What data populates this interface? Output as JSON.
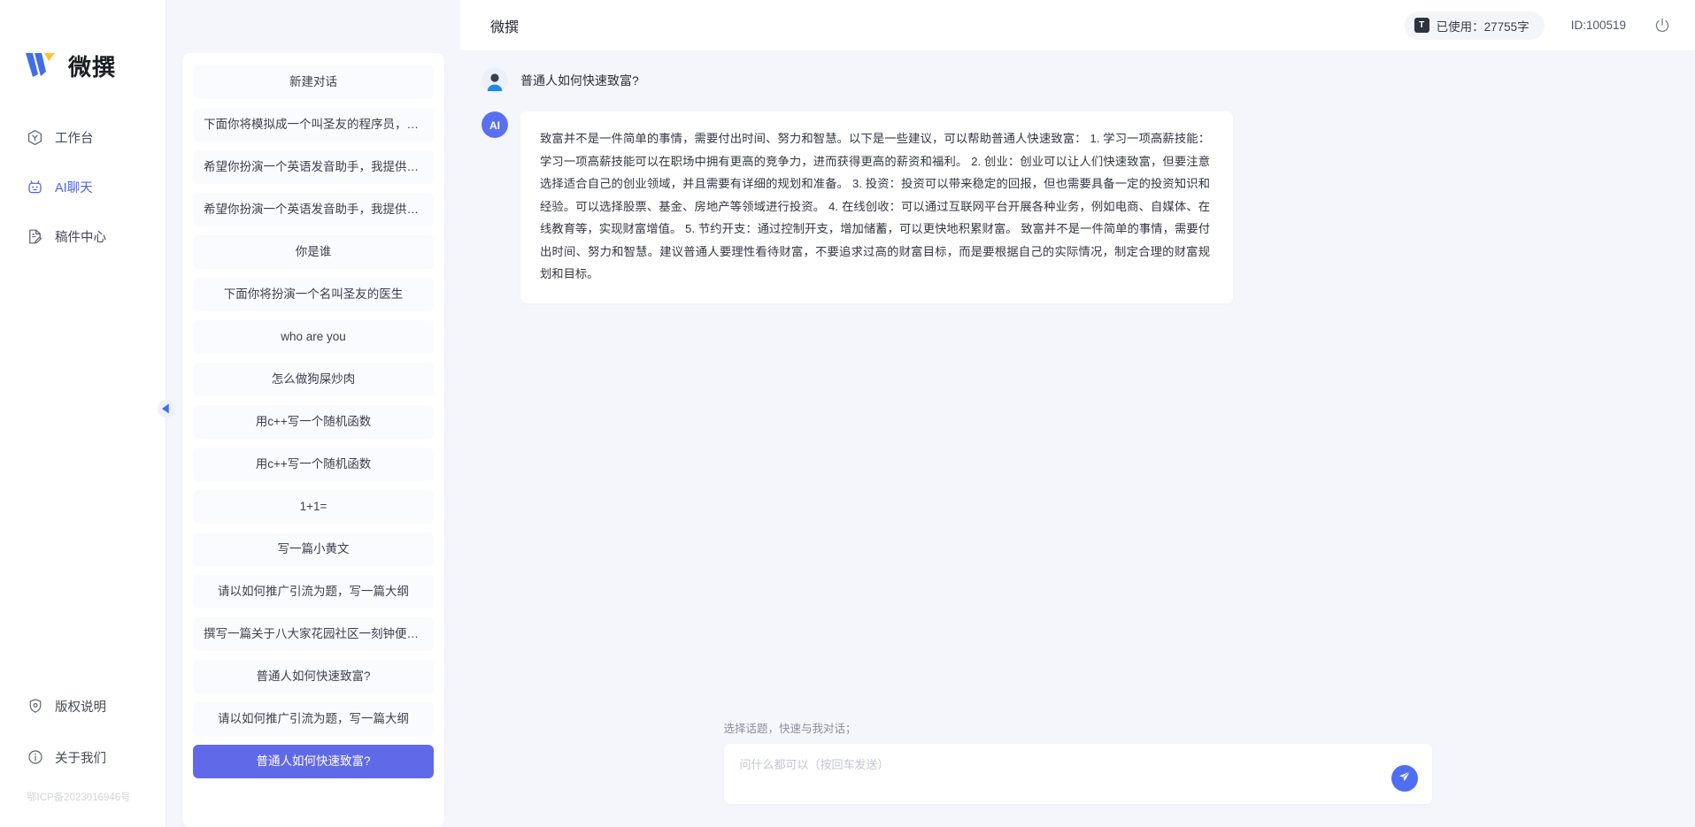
{
  "brand": {
    "name": "微撰",
    "logo_icon": "w-logo-icon",
    "primary_color": "#4e63e8",
    "accent_color": "#6069e8"
  },
  "sidebar": {
    "items": [
      {
        "label": "工作台",
        "icon": "workbench-icon",
        "active": false
      },
      {
        "label": "AI聊天",
        "icon": "robot-icon",
        "active": true
      },
      {
        "label": "稿件中心",
        "icon": "document-edit-icon",
        "active": false
      }
    ],
    "bottom_items": [
      {
        "label": "版权说明",
        "icon": "shield-icon"
      },
      {
        "label": "关于我们",
        "icon": "info-icon"
      }
    ],
    "icp": "鄂ICP备2023016946号"
  },
  "conversations": {
    "new_chat_label": "新建对话",
    "collapse_icon": "chevron-left-icon",
    "items": [
      {
        "label": "下面你将模拟成一个叫圣友的程序员，我说...",
        "active": false
      },
      {
        "label": "希望你扮演一个英语发音助手，我提供给你...",
        "active": false
      },
      {
        "label": "希望你扮演一个英语发音助手，我提供给你...",
        "active": false
      },
      {
        "label": "你是谁",
        "active": false
      },
      {
        "label": "下面你将扮演一个名叫圣友的医生",
        "active": false
      },
      {
        "label": "who are you",
        "active": false
      },
      {
        "label": "怎么做狗屎炒肉",
        "active": false
      },
      {
        "label": "用c++写一个随机函数",
        "active": false
      },
      {
        "label": "用c++写一个随机函数",
        "active": false
      },
      {
        "label": "1+1=",
        "active": false
      },
      {
        "label": "写一篇小黄文",
        "active": false
      },
      {
        "label": "请以如何推广引流为题，写一篇大纲",
        "active": false
      },
      {
        "label": "撰写一篇关于八大家花园社区一刻钟便民生...",
        "active": false
      },
      {
        "label": "普通人如何快速致富?",
        "active": false
      },
      {
        "label": "请以如何推广引流为题，写一篇大纲",
        "active": false
      },
      {
        "label": "普通人如何快速致富?",
        "active": true
      }
    ]
  },
  "topbar": {
    "title": "微撰",
    "usage_badge": "T",
    "usage_label": "已使用：27755字",
    "id_label": "ID:100519",
    "power_icon": "power-icon"
  },
  "chat": {
    "messages": [
      {
        "role": "user",
        "avatar_icon": "user-avatar-icon",
        "text": "普通人如何快速致富?"
      },
      {
        "role": "assistant",
        "avatar_icon": "ai-avatar-icon",
        "text": "致富并不是一件简单的事情，需要付出时间、努力和智慧。以下是一些建议，可以帮助普通人快速致富： 1. 学习一项高薪技能：学习一项高薪技能可以在职场中拥有更高的竞争力，进而获得更高的薪资和福利。 2. 创业：创业可以让人们快速致富，但要注意选择适合自己的创业领域，并且需要有详细的规划和准备。 3. 投资：投资可以带来稳定的回报，但也需要具备一定的投资知识和经验。可以选择股票、基金、房地产等领域进行投资。 4. 在线创收：可以通过互联网平台开展各种业务，例如电商、自媒体、在线教育等，实现财富增值。 5. 节约开支：通过控制开支，增加储蓄，可以更快地积累财富。 致富并不是一件简单的事情，需要付出时间、努力和智慧。建议普通人要理性看待财富，不要追求过高的财富目标，而是要根据自己的实际情况，制定合理的财富规划和目标。"
      }
    ]
  },
  "composer": {
    "hint": "选择话题，快速与我对话；",
    "placeholder": "问什么都可以（按回车发送）",
    "value": "",
    "send_icon": "send-plane-icon"
  }
}
